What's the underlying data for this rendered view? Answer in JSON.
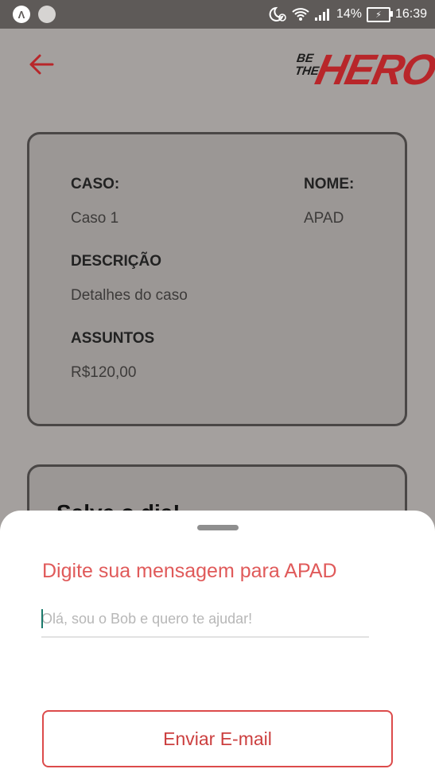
{
  "status_bar": {
    "battery_percent": "14%",
    "time": "16:39",
    "left_icon_letter": "Λ"
  },
  "header": {
    "logo_small_line1": "BE",
    "logo_small_line2": "THE",
    "logo_big": "HERO"
  },
  "case_card": {
    "case_label": "CASO:",
    "case_value": "Caso 1",
    "name_label": "NOME:",
    "name_value": "APAD",
    "description_label": "DESCRIÇÃO",
    "description_value": "Detalhes do caso",
    "subjects_label": "ASSUNTOS",
    "subjects_value": "R$120,00"
  },
  "contact_card": {
    "title": "Salve o dia!"
  },
  "bottom_sheet": {
    "title": "Digite sua mensagem para APAD",
    "message_placeholder": "Olá, sou o Bob e quero te ajudar!",
    "message_value": "",
    "send_button_label": "Enviar E-mail"
  },
  "colors": {
    "accent": "#e02041",
    "title_red": "#e05a5a",
    "overlay": "#a4a09e"
  }
}
